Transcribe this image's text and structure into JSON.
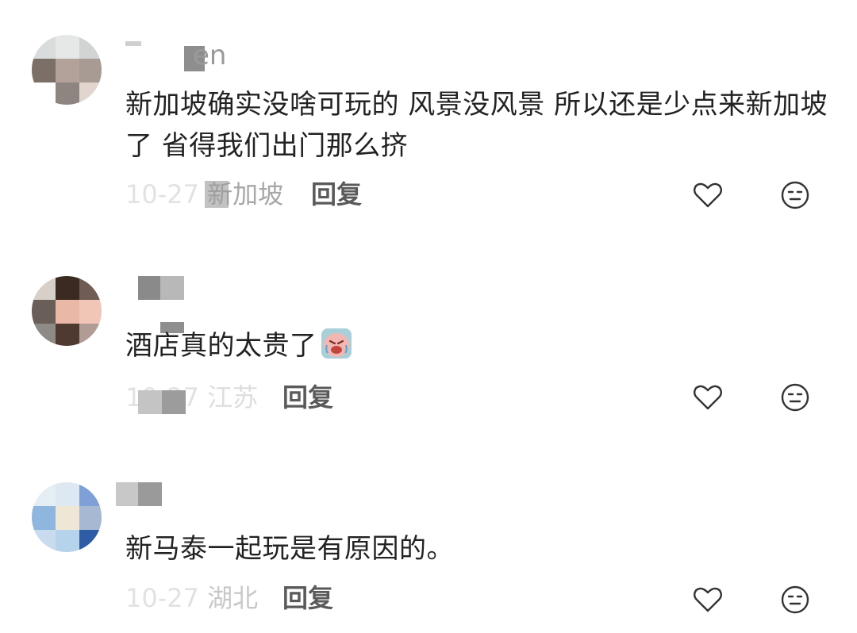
{
  "comments": [
    {
      "username": "en",
      "text": "新加坡确实没啥可玩的 风景没风景 所以还是少点来新加坡了 省得我们出门那么挤",
      "date": "10-27",
      "location": "新加坡",
      "reply_label": "回复"
    },
    {
      "username": "",
      "text": "酒店真的太贵了",
      "date": "10-27",
      "location": "江苏",
      "reply_label": "回复"
    },
    {
      "username": "",
      "text": "新马泰一起玩是有原因的。",
      "date": "10-27",
      "location": "湖北",
      "reply_label": "回复"
    }
  ],
  "icons": {
    "like": "heart-outline-icon",
    "dislike": "neutral-face-icon",
    "inline_emoji": "crying-face-emoji"
  },
  "colors": {
    "text": "#222222",
    "meta": "#b5b5b5",
    "reply": "#5a5a5a",
    "icon_stroke": "#333333"
  }
}
